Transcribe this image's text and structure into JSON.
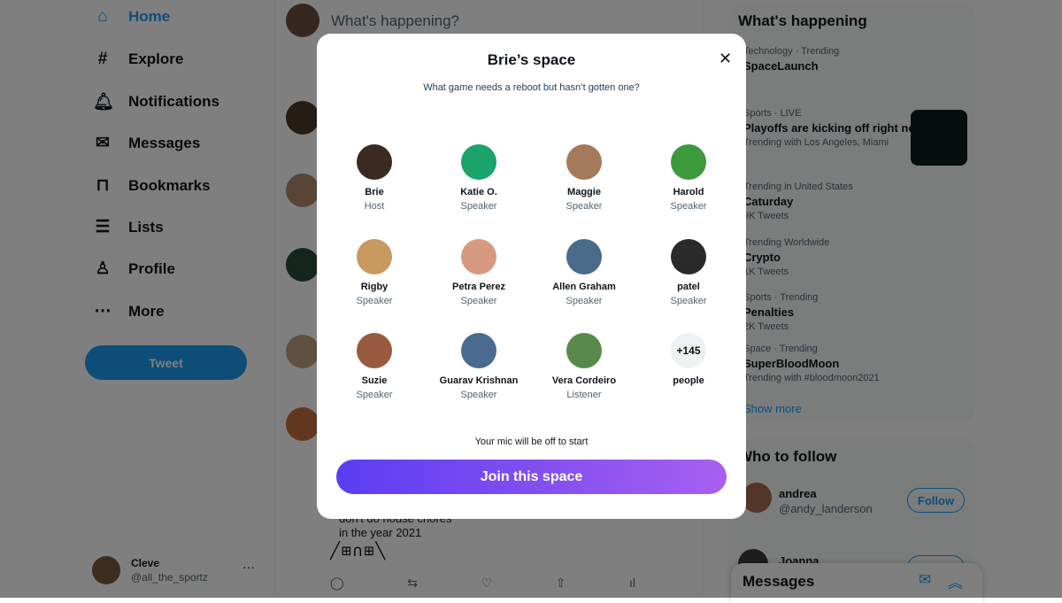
{
  "nav": {
    "items": [
      {
        "label": "Home",
        "icon": "home-icon",
        "glyph": "⌂"
      },
      {
        "label": "Explore",
        "icon": "hashtag-icon",
        "glyph": "#"
      },
      {
        "label": "Notifications",
        "icon": "bell-icon",
        "glyph": "🔔︎"
      },
      {
        "label": "Messages",
        "icon": "mail-icon",
        "glyph": "✉"
      },
      {
        "label": "Bookmarks",
        "icon": "bookmark-icon",
        "glyph": "⊓"
      },
      {
        "label": "Lists",
        "icon": "list-icon",
        "glyph": "☰"
      },
      {
        "label": "Profile",
        "icon": "person-icon",
        "glyph": "♙"
      },
      {
        "label": "More",
        "icon": "more-icon",
        "glyph": "⋯"
      }
    ],
    "tweet_label": "Tweet"
  },
  "account": {
    "name": "Cleve",
    "handle": "@all_the_sportz",
    "menu": "···"
  },
  "composer": {
    "placeholder": "What's happening?"
  },
  "feed": {
    "tweet_text_1": "don't do house chores",
    "tweet_text_2": "in the year 2021"
  },
  "trends": {
    "title": "What's happening",
    "items": [
      {
        "meta": "Technology · Trending",
        "name": "SpaceLaunch",
        "sub": ""
      },
      {
        "meta": "Sports · LIVE",
        "name": "Playoffs are kicking off right now",
        "sub": "Trending with Los Angeles, Miami"
      },
      {
        "meta": "Trending in United States",
        "name": "Caturday",
        "sub": "9K Tweets"
      },
      {
        "meta": "Trending Worldwide",
        "name": "Crypto",
        "sub": "1K Tweets"
      },
      {
        "meta": "Sports · Trending",
        "name": "Penalties",
        "sub": "2K Tweets"
      },
      {
        "meta": "Space · Trending",
        "name": "SuperBloodMoon",
        "sub": "Trending with #bloodmoon2021"
      }
    ],
    "show_more": "Show more"
  },
  "who_to_follow": {
    "title": "Who to follow",
    "users": [
      {
        "name": "andrea",
        "handle": "@andy_landerson",
        "button": "Follow"
      },
      {
        "name": "Joanna",
        "handle": "",
        "button": "Follow"
      }
    ]
  },
  "messages_dock": {
    "title": "Messages"
  },
  "modal": {
    "title": "Brie’s space",
    "subtitle": "What game needs a reboot but hasn’t gotten one?",
    "participants": [
      {
        "name": "Brie",
        "role": "Host",
        "color": "#3a2a20"
      },
      {
        "name": "Katie O.",
        "role": "Speaker",
        "color": "#1aa36a"
      },
      {
        "name": "Maggie",
        "role": "Speaker",
        "color": "#a57a5a"
      },
      {
        "name": "Harold",
        "role": "Speaker",
        "color": "#3c9a3c"
      },
      {
        "name": "Rigby",
        "role": "Speaker",
        "color": "#c89a60"
      },
      {
        "name": "Petra Perez",
        "role": "Speaker",
        "color": "#d79a80"
      },
      {
        "name": "Allen Graham",
        "role": "Speaker",
        "color": "#4a6a8a"
      },
      {
        "name": "patel",
        "role": "Speaker",
        "color": "#2a2a2a"
      },
      {
        "name": "Suzie",
        "role": "Speaker",
        "color": "#9a5a40"
      },
      {
        "name": "Guarav Krishnan",
        "role": "Speaker",
        "color": "#4a6a90"
      },
      {
        "name": "Vera Cordeiro",
        "role": "Listener",
        "color": "#5a8a4a"
      },
      {
        "name": "people",
        "role": "",
        "count": "+145"
      }
    ],
    "mic_note": "Your mic will be off to start",
    "join_label": "Join this space",
    "close": "✕"
  }
}
